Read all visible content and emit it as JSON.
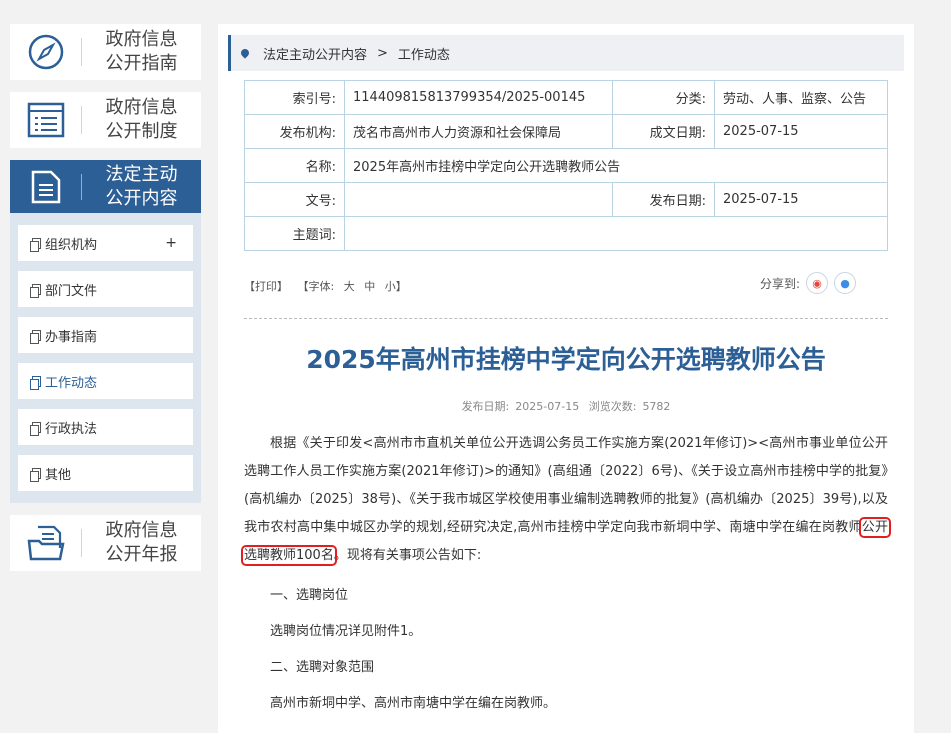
{
  "sidebar": {
    "guide": {
      "line1": "政府信息",
      "line2": "公开指南"
    },
    "system": {
      "line1": "政府信息",
      "line2": "公开制度"
    },
    "statutory": {
      "line1": "法定主动",
      "line2": "公开内容"
    },
    "annual": {
      "line1": "政府信息",
      "line2": "公开年报"
    },
    "submenu": [
      {
        "label": "组织机构",
        "plus": "+"
      },
      {
        "label": "部门文件"
      },
      {
        "label": "办事指南"
      },
      {
        "label": "工作动态"
      },
      {
        "label": "行政执法"
      },
      {
        "label": "其他"
      }
    ]
  },
  "breadcrumb": {
    "level1": "法定主动公开内容",
    "sep": ">",
    "level2": "工作动态"
  },
  "meta": {
    "index_label": "索引号:",
    "index_value": "114409815813799354/2025-00145",
    "category_label": "分类:",
    "category_value": "劳动、人事、监察、公告",
    "org_label": "发布机构:",
    "org_value": "茂名市高州市人力资源和社会保障局",
    "date_label": "成文日期:",
    "date_value": "2025-07-15",
    "name_label": "名称:",
    "name_value": "2025年高州市挂榜中学定向公开选聘教师公告",
    "docno_label": "文号:",
    "docno_value": "",
    "pubdate_label": "发布日期:",
    "pubdate_value": "2025-07-15",
    "subject_label": "主题词:",
    "subject_value": ""
  },
  "tools": {
    "print": "【打印】",
    "font": "【字体:",
    "large": "大",
    "medium": "中",
    "small": "小】",
    "share": "分享到:"
  },
  "article": {
    "title": "2025年高州市挂榜中学定向公开选聘教师公告",
    "pub_label": "发布日期:",
    "pub_date": "2025-07-15",
    "views_label": "浏览次数:",
    "views": "5782",
    "para1_a": "根据《关于印发<高州市市直机关单位公开选调公务员工作实施方案(2021年修订)><高州市事业单位公开选聘工作人员工作实施方案(2021年修订)>的通知》(高组通〔2022〕6号)、《关于设立高州市挂榜中学的批复》(高机编办〔2025〕38号)、《关于我市城区学校使用事业编制选聘教师的批复》(高机编办〔2025〕39号),以及我市农村高中集中城区办学的规划,经研究决定,高州市挂榜中学定向我市新垌中学、南塘中学在编在岗教师",
    "para1_hl": "公开选聘教师100名",
    "para1_b": "。现将有关事项公告如下:",
    "s1": "一、选聘岗位",
    "s1_text": "选聘岗位情况详见附件1。",
    "s2": "二、选聘对象范围",
    "s2_text": "高州市新垌中学、高州市南塘中学在编在岗教师。"
  }
}
